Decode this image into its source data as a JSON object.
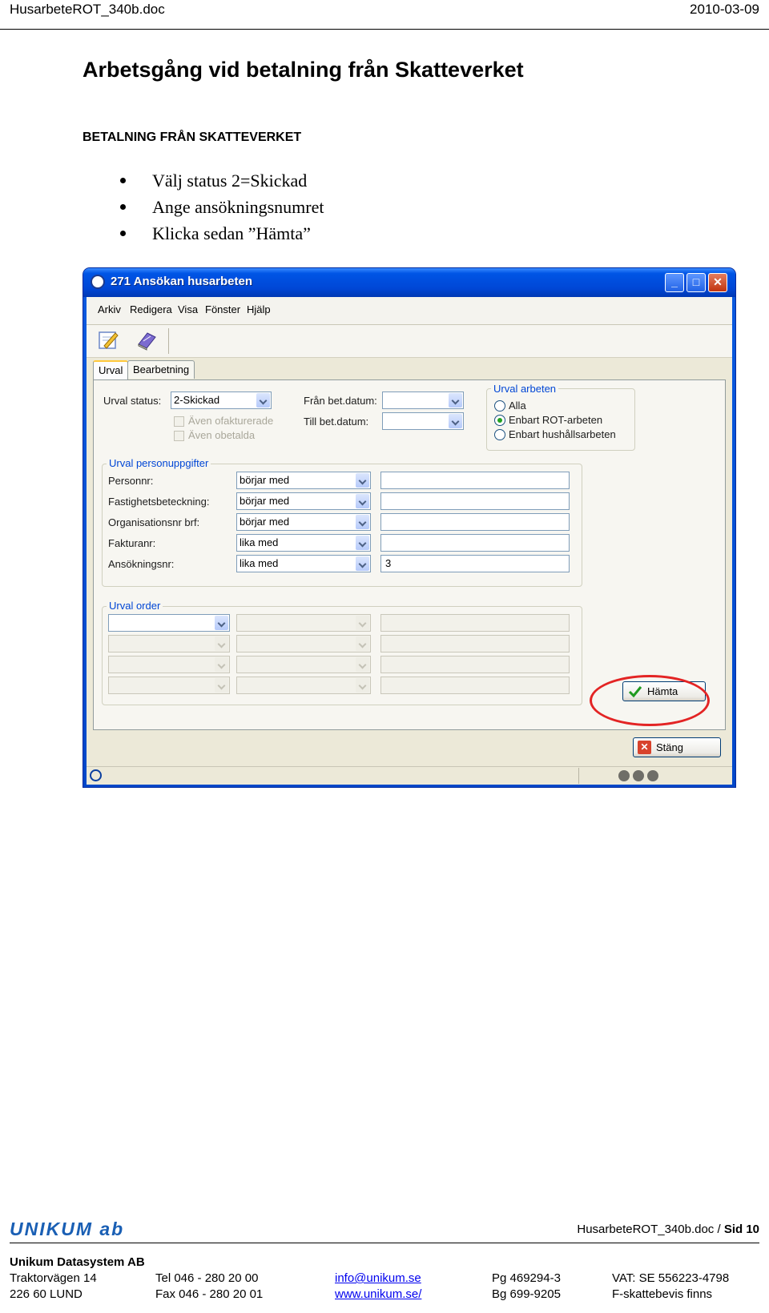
{
  "header": {
    "doc_name": "HusarbeteROT_340b.doc",
    "date": "2010-03-09"
  },
  "heading": "Arbetsgång vid betalning från Skatteverket",
  "subheading": "BETALNING FRÅN SKATTEVERKET",
  "bullets": [
    "Välj status 2=Skickad",
    "Ange ansökningsnumret",
    "Klicka sedan ”Hämta”"
  ],
  "window": {
    "title": "271 Ansökan husarbeten",
    "menu": [
      "Arkiv",
      "Redigera",
      "Visa",
      "Fönster",
      "Hjälp"
    ],
    "tabs": [
      "Urval",
      "Bearbetning"
    ],
    "urval_status_label": "Urval status:",
    "urval_status_value": "2-Skickad",
    "checkbox_oafakturerade": "Även ofakturerade",
    "checkbox_obetalda": "Även obetalda",
    "fran_bet_datum": "Från bet.datum:",
    "till_bet_datum": "Till bet.datum:",
    "arbeten_group": {
      "title": "Urval arbeten",
      "options": [
        "Alla",
        "Enbart ROT-arbeten",
        "Enbart hushållsarbeten"
      ],
      "selected": "Enbart ROT-arbeten"
    },
    "person_group": {
      "title": "Urval personuppgifter",
      "rows": [
        {
          "label": "Personnr:",
          "op": "börjar med",
          "value": ""
        },
        {
          "label": "Fastighetsbeteckning:",
          "op": "börjar med",
          "value": ""
        },
        {
          "label": "Organisationsnr brf:",
          "op": "börjar med",
          "value": ""
        },
        {
          "label": "Fakturanr:",
          "op": "lika med",
          "value": ""
        },
        {
          "label": "Ansökningsnr:",
          "op": "lika med",
          "value": "3"
        }
      ]
    },
    "order_group": {
      "title": "Urval order"
    },
    "hamta_button": "Hämta",
    "stang_button": "Stäng"
  },
  "footer": {
    "logo": "UNIKUM ab",
    "doc_page": "HusarbeteROT_340b.doc / ",
    "page_label": "Sid 10",
    "company": "Unikum Datasystem AB",
    "address1": "Traktorvägen 14",
    "address2": "226 60  LUND",
    "tel": "Tel  046 - 280 20 00",
    "fax": "Fax  046 - 280 20 01",
    "email": "info@unikum.se",
    "web": "www.unikum.se/",
    "pg": "Pg  469294-3",
    "bg": "Bg  699-9205",
    "vat": "VAT: SE 556223-4798",
    "fskatt": "F-skattebevis finns"
  },
  "colors": {
    "accent_blue": "#0055e5",
    "highlight_red": "#e32424"
  }
}
